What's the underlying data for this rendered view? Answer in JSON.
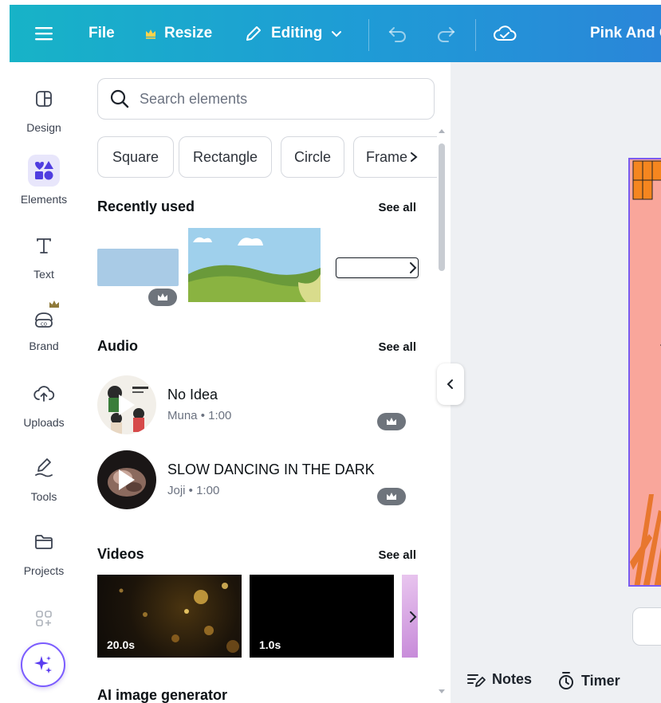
{
  "topbar": {
    "file_label": "File",
    "resize_label": "Resize",
    "editing_label": "Editing",
    "design_title": "Pink And G"
  },
  "rail": {
    "items": [
      {
        "label": "Design",
        "icon": "layout-icon"
      },
      {
        "label": "Elements",
        "icon": "shapes-icon",
        "active": true
      },
      {
        "label": "Text",
        "icon": "text-icon"
      },
      {
        "label": "Brand",
        "icon": "brand-kit-icon"
      },
      {
        "label": "Uploads",
        "icon": "cloud-upload-icon"
      },
      {
        "label": "Tools",
        "icon": "pen-tool-icon"
      },
      {
        "label": "Projects",
        "icon": "folder-icon"
      }
    ]
  },
  "search": {
    "placeholder": "Search elements"
  },
  "chips": [
    "Square",
    "Rectangle",
    "Circle",
    "Frame"
  ],
  "recent": {
    "title": "Recently used",
    "see_all": "See all"
  },
  "audio": {
    "title": "Audio",
    "see_all": "See all",
    "tracks": [
      {
        "title": "No Idea",
        "meta": "Muna • 1:00"
      },
      {
        "title": "SLOW DANCING IN THE DARK",
        "meta": "Joji • 1:00"
      }
    ]
  },
  "videos": {
    "title": "Videos",
    "see_all": "See all",
    "items": [
      {
        "duration": "20.0s"
      },
      {
        "duration": "1.0s"
      }
    ]
  },
  "ai_generator": {
    "title": "AI image generator"
  },
  "footer": {
    "notes_label": "Notes",
    "timer_label": "Timer"
  },
  "colors": {
    "topbar_start": "#17b3c7",
    "topbar_end": "#2a86d9",
    "accent": "#7b5cff",
    "design_bg": "#f9a69b",
    "design_orange": "#f5861f"
  }
}
